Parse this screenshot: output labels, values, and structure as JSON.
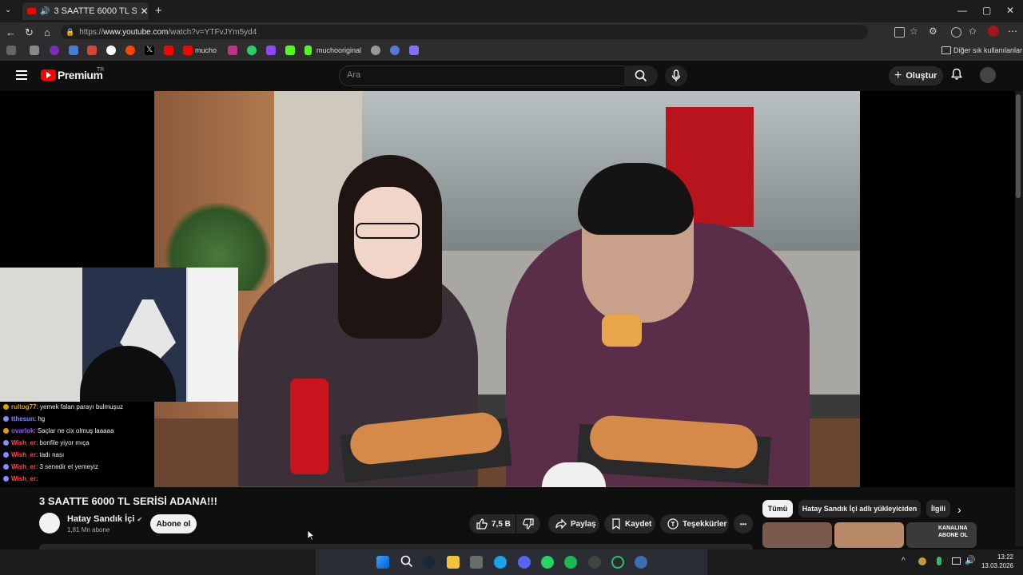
{
  "browser": {
    "tab_title": "3 SAATTE 6000 TL SERİSİ ADANA!!!",
    "tab_close": "✕",
    "new_tab": "+",
    "url_prefix": "https://",
    "url_host": "www.youtube.com",
    "url_path": "/watch?v=YTFvJYm5yd4",
    "window_minimize": "—",
    "window_maximize": "▢",
    "window_close": "✕",
    "bookmarks": [
      {
        "label": "mucho",
        "icon": "youtube-icon"
      },
      {
        "label": "muchooriginal",
        "icon": "kick-icon"
      }
    ],
    "other_bookmarks": "Diğer sık kullanılanlar",
    "colors": {
      "youtube_red": "#ff0000",
      "kick_green": "#53fc18",
      "accent": "#3ea6ff"
    }
  },
  "youtube": {
    "logo_text": "Premium",
    "logo_region": "TR",
    "search_placeholder": "Ara",
    "create_label": "Oluştur",
    "video_title": "3 SAATTE 6000 TL SERİSİ ADANA!!!",
    "channel_name": "Hatay Sandık İçi",
    "channel_verified": "✔",
    "subscriber_count": "1,81 Mn abone",
    "subscribe_label": "Abone ol",
    "like_count": "7,5 B",
    "share_label": "Paylaş",
    "save_label": "Kaydet",
    "thanks_label": "Teşekkürler",
    "more_label": "•••",
    "chips": [
      "Tümü",
      "Hatay Sandık İçi adlı yükleyiciden",
      "İlgili"
    ],
    "thumbnail_text": "KANALINA ABONE OL"
  },
  "stream_chat": [
    {
      "user": "rultog77",
      "message": ": yemek falan parayı bulmuşuz",
      "color": "#e0a000"
    },
    {
      "user": "tthesun",
      "message": ": hg",
      "color": "#8a8aff"
    },
    {
      "user": "ovarlok",
      "message": ": Saçlar ne cix olmuş laaaaa",
      "color": "#9b59ff"
    },
    {
      "user": "Wish_er",
      "message": ": bonfile yiyor mıça",
      "color": "#ff4a4a"
    },
    {
      "user": "Wish_er",
      "message": ": tadı nası",
      "color": "#ff4a4a"
    },
    {
      "user": "Wish_er",
      "message": ": 3 senedir et yemeyiz",
      "color": "#ff4a4a"
    },
    {
      "user": "Wish_er",
      "message": ":",
      "color": "#ff4a4a"
    }
  ],
  "taskbar": {
    "time": "13:22",
    "date": "13.03.2026"
  }
}
